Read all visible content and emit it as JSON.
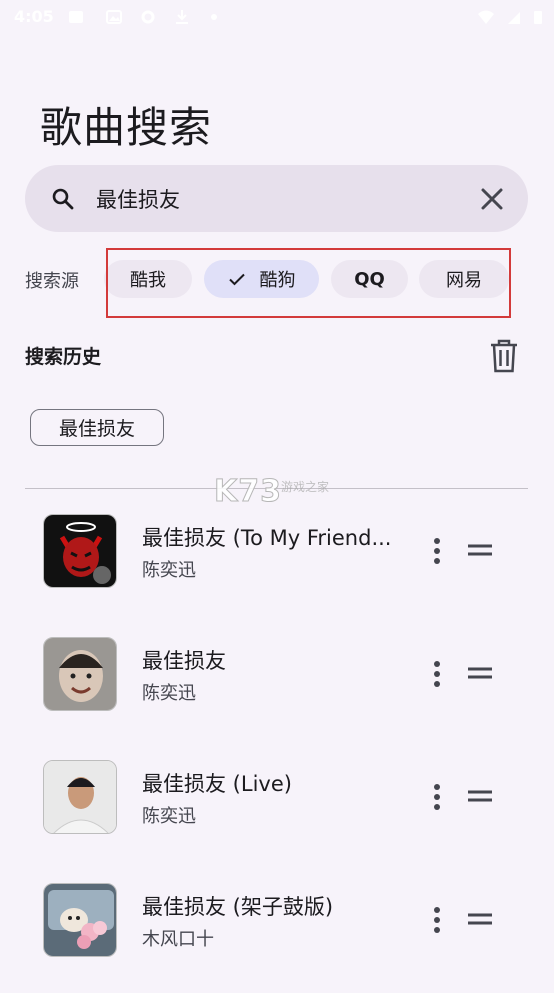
{
  "status_bar": {
    "time": "4:05"
  },
  "page": {
    "title": "歌曲搜索"
  },
  "search": {
    "value": "最佳损友",
    "placeholder": ""
  },
  "sources": {
    "label": "搜索源",
    "chips": [
      {
        "label": "酷我",
        "selected": false
      },
      {
        "label": "酷狗",
        "selected": true
      },
      {
        "label": "QQ",
        "selected": false
      },
      {
        "label": "网易",
        "selected": false
      }
    ]
  },
  "history": {
    "title": "搜索历史",
    "items": [
      "最佳损友"
    ]
  },
  "watermark": {
    "main": "K73",
    "sub": "游戏之家"
  },
  "results": [
    {
      "title": "最佳损友 (To My Friend...",
      "artist": "陈奕迅",
      "cover_icon": "devil-avatar-icon"
    },
    {
      "title": "最佳损友",
      "artist": "陈奕迅",
      "cover_icon": "child-photo-icon"
    },
    {
      "title": "最佳损友 (Live)",
      "artist": "陈奕迅",
      "cover_icon": "singer-photo-icon"
    },
    {
      "title": "最佳损友 (架子鼓版)",
      "artist": "木风口十",
      "cover_icon": "dog-with-flowers-icon"
    }
  ],
  "colors": {
    "background": "#f7f3fa",
    "search_bg": "#e7e0ec",
    "chip_selected": "#e0e0f8",
    "highlight_border": "#d33a3a"
  }
}
